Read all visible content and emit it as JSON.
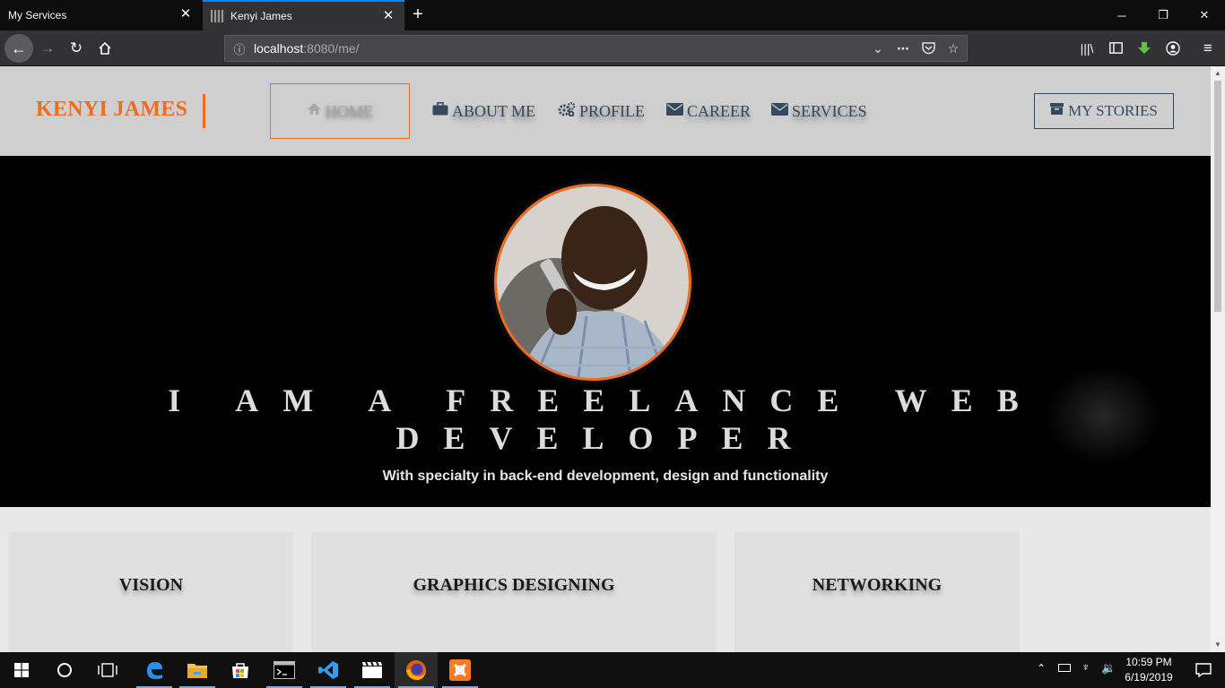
{
  "browser": {
    "tabs": [
      {
        "title": "My Services",
        "active": false
      },
      {
        "title": "Kenyi James",
        "active": true
      }
    ],
    "new_tab_symbol": "+",
    "close_symbol": "✕",
    "url": {
      "host": "localhost",
      "rest": ":8080/me/"
    },
    "window_buttons": {
      "minimize": "─",
      "restore": "❐",
      "close": "✕"
    }
  },
  "site": {
    "brand": "KENYI JAMES",
    "menu": [
      {
        "label": "HOME",
        "icon": "home-icon",
        "active": true
      },
      {
        "label": "ABOUT ME",
        "icon": "briefcase-icon",
        "active": false
      },
      {
        "label": "PROFILE",
        "icon": "gears-icon",
        "active": false
      },
      {
        "label": "CAREER",
        "icon": "envelope-icon",
        "active": false
      },
      {
        "label": "SERVICES",
        "icon": "envelope-icon",
        "active": false
      }
    ],
    "stories_button": "MY STORIES",
    "hero": {
      "title": "I AM A FREELANCE WEB DEVELOPER",
      "subtitle": "With specialty in back-end development, design and functionality"
    },
    "cards": [
      "VISION",
      "GRAPHICS DESIGNING",
      "NETWORKING"
    ]
  },
  "taskbar": {
    "clock": {
      "time": "10:59 PM",
      "date": "6/19/2019"
    },
    "apps": [
      "edge-icon",
      "file-explorer-icon",
      "store-icon",
      "terminal-icon",
      "vscode-icon",
      "video-editor-icon",
      "firefox-icon",
      "xampp-icon"
    ]
  },
  "colors": {
    "accent": "#f26b21",
    "nav_text": "#34495e",
    "firefox_focus": "#0a84ff"
  }
}
